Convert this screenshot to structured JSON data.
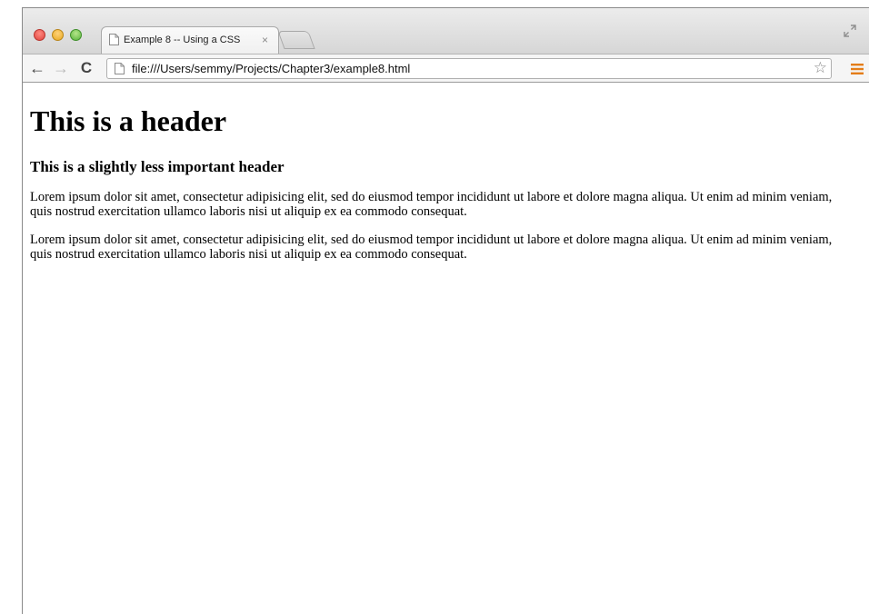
{
  "browser": {
    "tab_title": "Example 8 -- Using a CSS",
    "tab_close": "×",
    "url": "file:///Users/semmy/Projects/Chapter3/example8.html",
    "icons": {
      "close": "close-window-icon",
      "minimize": "minimize-window-icon",
      "maximize": "zoom-window-icon",
      "fullscreen": "fullscreen-icon",
      "back": "back-arrow-icon",
      "forward": "forward-arrow-icon",
      "reload": "reload-icon",
      "star": "bookmark-star-icon",
      "menu": "hamburger-menu-icon"
    },
    "colors": {
      "menu_accent": "#e47d18",
      "close": "#e0443e",
      "minimize": "#e8a91f",
      "maximize": "#56b33a"
    },
    "glyphs": {
      "back": "←",
      "forward": "→",
      "reload": "C",
      "star": "☆"
    }
  },
  "page": {
    "heading": "This is a header",
    "subheading": "This is a slightly less important header",
    "paragraphs": [
      "Lorem ipsum dolor sit amet, consectetur adipisicing elit, sed do eiusmod tempor incididunt ut labore et dolore magna aliqua. Ut enim ad minim veniam, quis nostrud exercitation ullamco laboris nisi ut aliquip ex ea commodo consequat.",
      "Lorem ipsum dolor sit amet, consectetur adipisicing elit, sed do eiusmod tempor incididunt ut labore et dolore magna aliqua. Ut enim ad minim veniam, quis nostrud exercitation ullamco laboris nisi ut aliquip ex ea commodo consequat."
    ]
  }
}
